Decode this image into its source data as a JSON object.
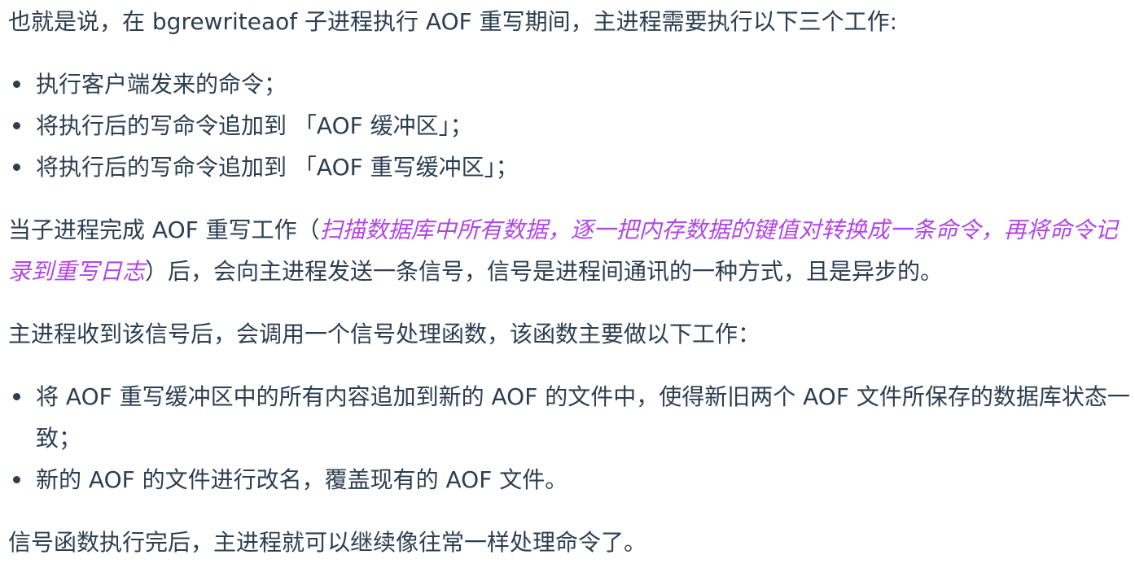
{
  "paragraphs": {
    "intro": "也就是说，在 bgrewriteaof 子进程执行 AOF 重写期间，主进程需要执行以下三个工作:",
    "during_list": [
      "执行客户端发来的命令；",
      "将执行后的写命令追加到 「AOF 缓冲区」；",
      "将执行后的写命令追加到 「AOF 重写缓冲区」；"
    ],
    "completion": {
      "before": "当子进程完成 AOF 重写工作（",
      "emphasis": "扫描数据库中所有数据，逐一把内存数据的键值对转换成一条命令，再将命令记录到重写日志",
      "after": "）后，会向主进程发送一条信号，信号是进程间通讯的一种方式，且是异步的。"
    },
    "signal_intro": "主进程收到该信号后，会调用一个信号处理函数，该函数主要做以下工作：",
    "signal_list": [
      "将 AOF 重写缓冲区中的所有内容追加到新的 AOF 的文件中，使得新旧两个 AOF 文件所保存的数据库状态一致；",
      "新的 AOF 的文件进行改名，覆盖现有的 AOF 文件。"
    ],
    "conclusion": "信号函数执行完后，主进程就可以继续像往常一样处理命令了。"
  },
  "colors": {
    "text": "#2c3e50",
    "emphasis": "#b245e8"
  }
}
